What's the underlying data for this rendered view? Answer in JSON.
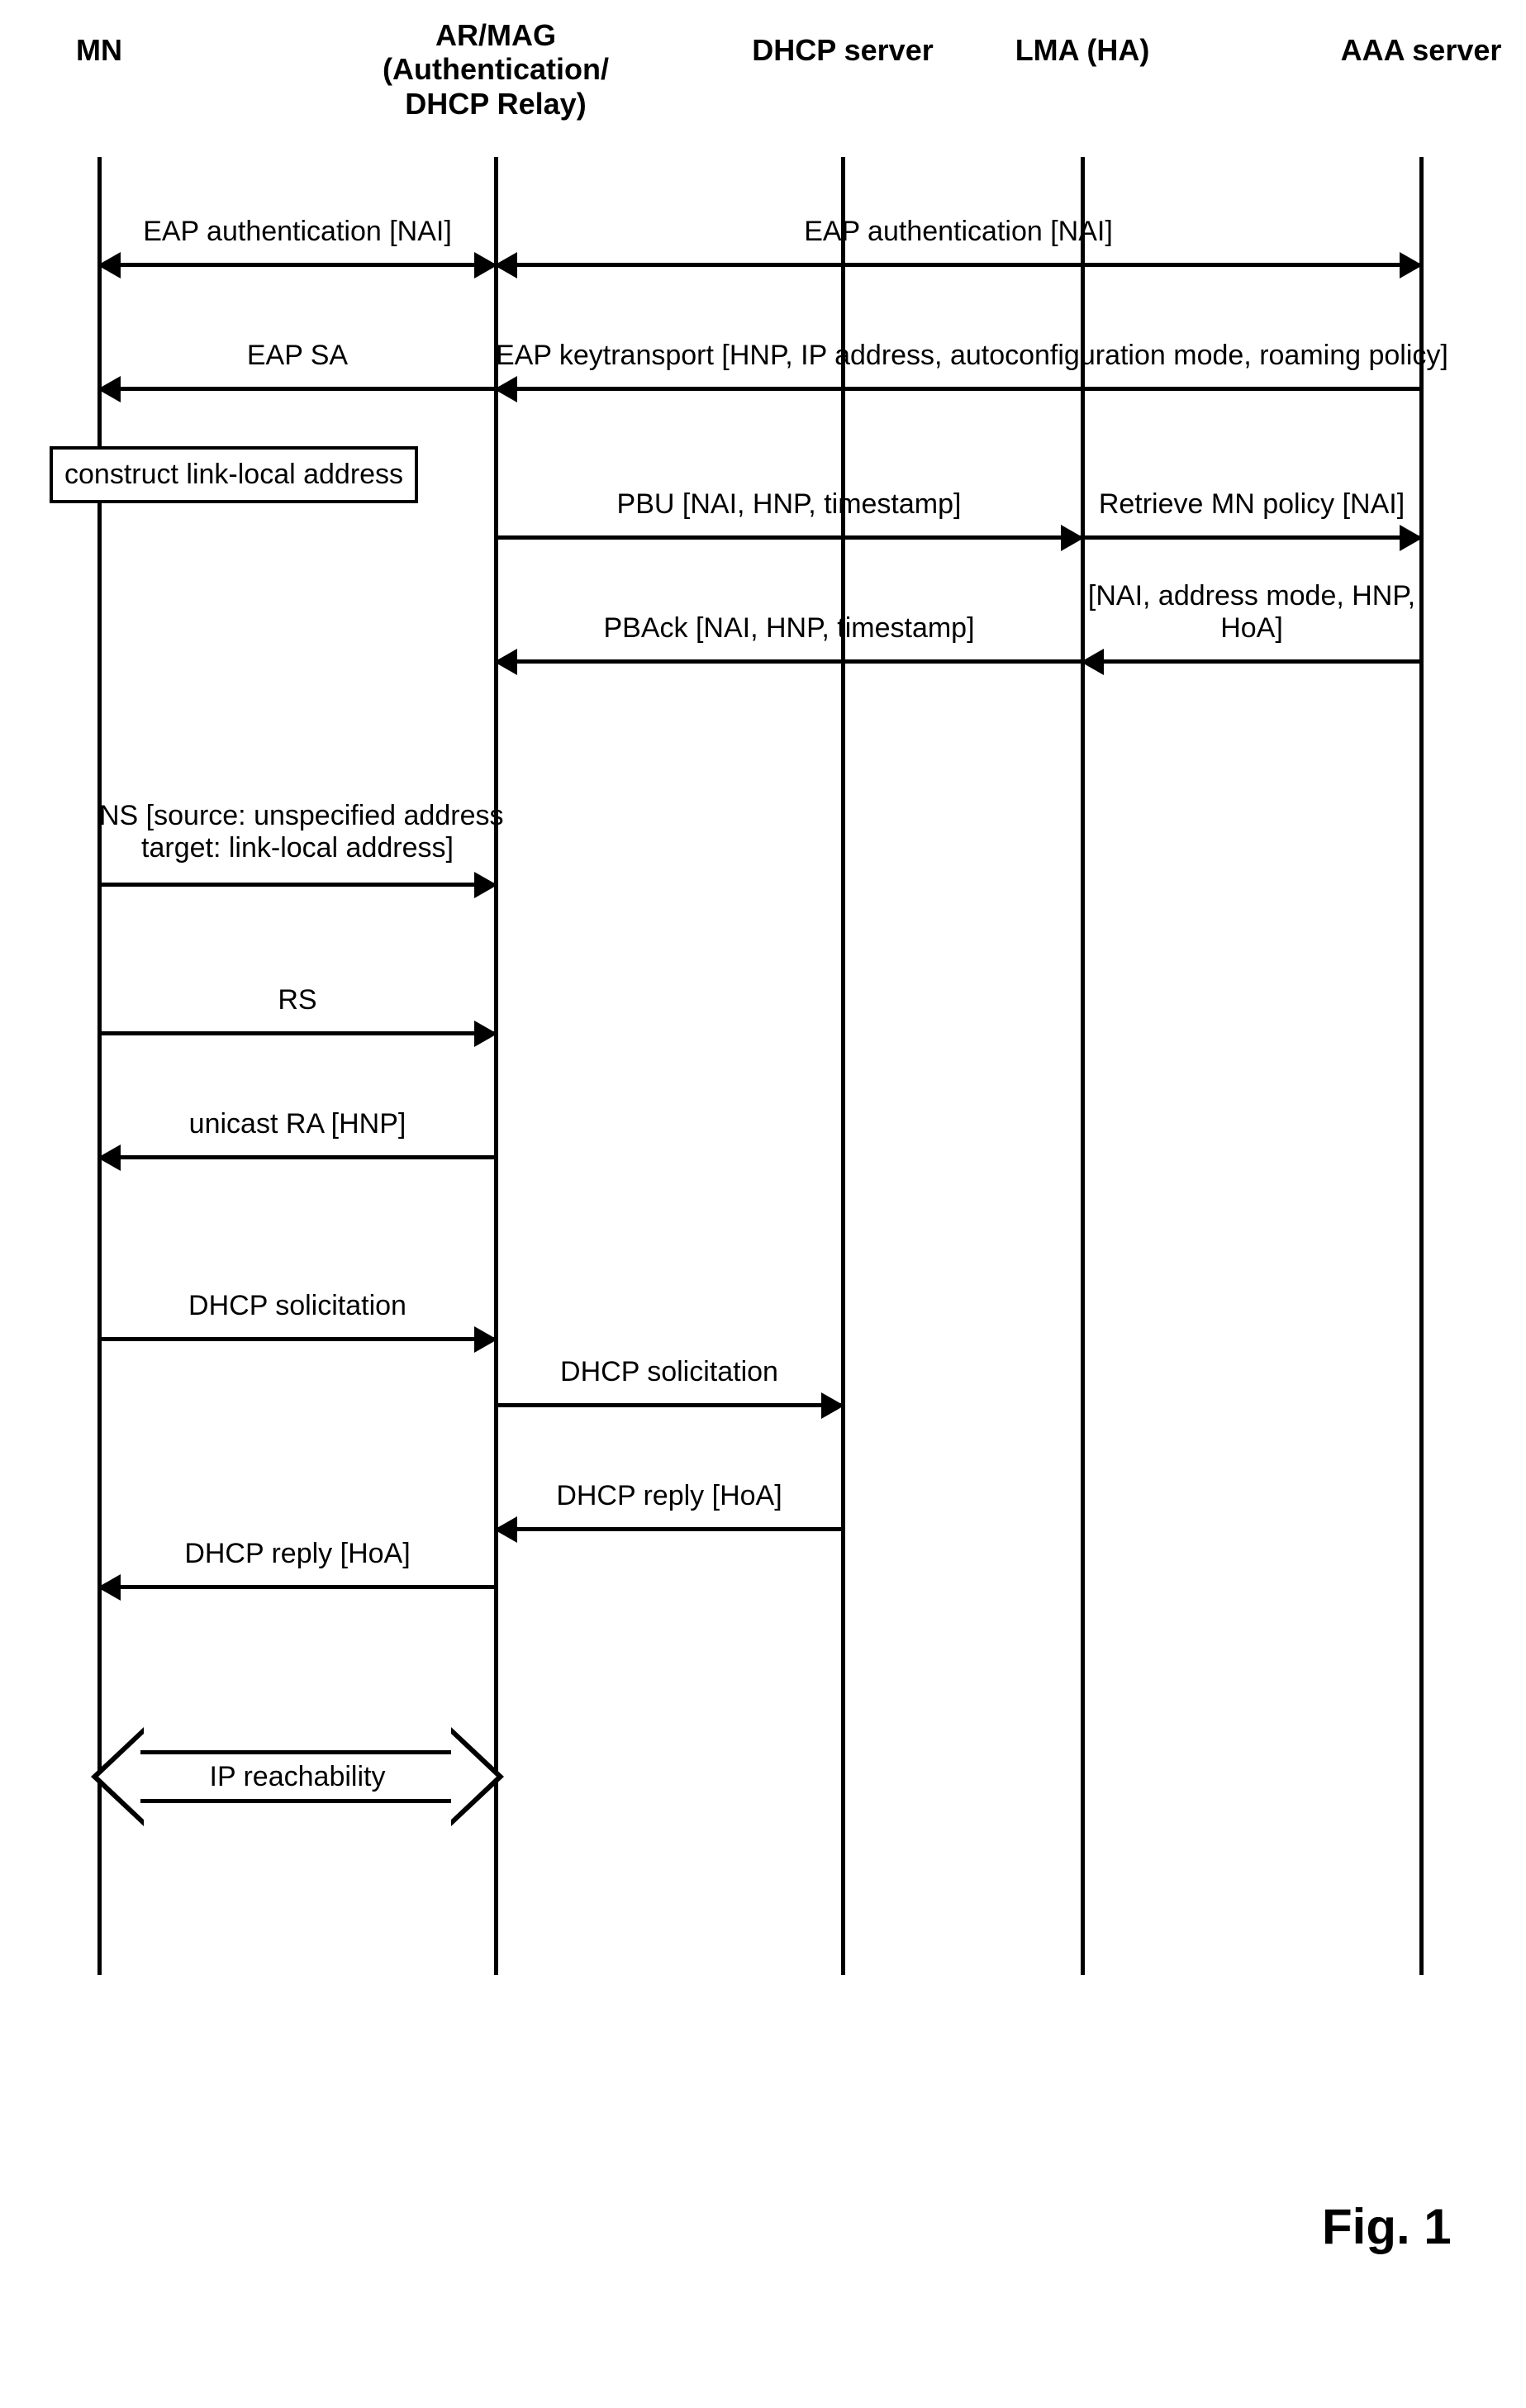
{
  "actors": {
    "mn": "MN",
    "armag": "AR/MAG\n(Authentication/\nDHCP Relay)",
    "dhcp": "DHCP server",
    "lma": "LMA (HA)",
    "aaa": "AAA server"
  },
  "messages": {
    "eap_auth_mn_ar": "EAP authentication [NAI]",
    "eap_auth_ar_aaa": "EAP authentication [NAI]",
    "eap_keytransport": "EAP keytransport [HNP, IP address, autoconfiguration mode, roaming policy]",
    "eap_sa": "EAP SA",
    "pbu": "PBU [NAI, HNP, timestamp]",
    "retrieve_policy": "Retrieve MN policy [NAI]",
    "pback": "PBAck [NAI, HNP, timestamp]",
    "policy_reply": "[NAI, address mode, HNP, HoA]",
    "ns": "NS [source: unspecified address\ntarget: link-local address]",
    "rs": "RS",
    "ra": "unicast RA [HNP]",
    "dhcp_sol_mn": "DHCP solicitation",
    "dhcp_sol_ar": "DHCP solicitation",
    "dhcp_reply_ar": "DHCP reply [HoA]",
    "dhcp_reply_mn": "DHCP reply [HoA]",
    "ip_reach": "IP reachability"
  },
  "note_linklocal": "construct link-local\naddress",
  "figure_label": "Fig. 1",
  "chart_data": {
    "type": "sequence-diagram",
    "actors": [
      "MN",
      "AR/MAG (Authentication/DHCP Relay)",
      "DHCP server",
      "LMA (HA)",
      "AAA server"
    ],
    "events": [
      {
        "from": "MN",
        "to": "AR/MAG",
        "label": "EAP authentication [NAI]",
        "dir": "both"
      },
      {
        "from": "AR/MAG",
        "to": "AAA server",
        "label": "EAP authentication [NAI]",
        "dir": "both"
      },
      {
        "from": "AAA server",
        "to": "AR/MAG",
        "label": "EAP keytransport [HNP, IP address, autoconfiguration mode, roaming policy]",
        "dir": "left"
      },
      {
        "from": "AR/MAG",
        "to": "MN",
        "label": "EAP SA",
        "dir": "left"
      },
      {
        "actor": "MN",
        "note": "construct link-local address"
      },
      {
        "from": "AR/MAG",
        "to": "LMA (HA)",
        "label": "PBU [NAI, HNP, timestamp]",
        "dir": "right"
      },
      {
        "from": "LMA (HA)",
        "to": "AAA server",
        "label": "Retrieve MN policy [NAI]",
        "dir": "right"
      },
      {
        "from": "LMA (HA)",
        "to": "AR/MAG",
        "label": "PBAck [NAI, HNP, timestamp]",
        "dir": "left"
      },
      {
        "from": "AAA server",
        "to": "LMA (HA)",
        "label": "[NAI, address mode, HNP, HoA]",
        "dir": "left"
      },
      {
        "from": "MN",
        "to": "AR/MAG",
        "label": "NS [source: unspecified address target: link-local address]",
        "dir": "right"
      },
      {
        "from": "MN",
        "to": "AR/MAG",
        "label": "RS",
        "dir": "right"
      },
      {
        "from": "AR/MAG",
        "to": "MN",
        "label": "unicast RA [HNP]",
        "dir": "left"
      },
      {
        "from": "MN",
        "to": "AR/MAG",
        "label": "DHCP solicitation",
        "dir": "right"
      },
      {
        "from": "AR/MAG",
        "to": "DHCP server",
        "label": "DHCP solicitation",
        "dir": "right"
      },
      {
        "from": "DHCP server",
        "to": "AR/MAG",
        "label": "DHCP reply [HoA]",
        "dir": "left"
      },
      {
        "from": "AR/MAG",
        "to": "MN",
        "label": "DHCP reply [HoA]",
        "dir": "left"
      },
      {
        "from": "MN",
        "to": "AR/MAG",
        "label": "IP reachability",
        "dir": "both-block"
      }
    ]
  }
}
